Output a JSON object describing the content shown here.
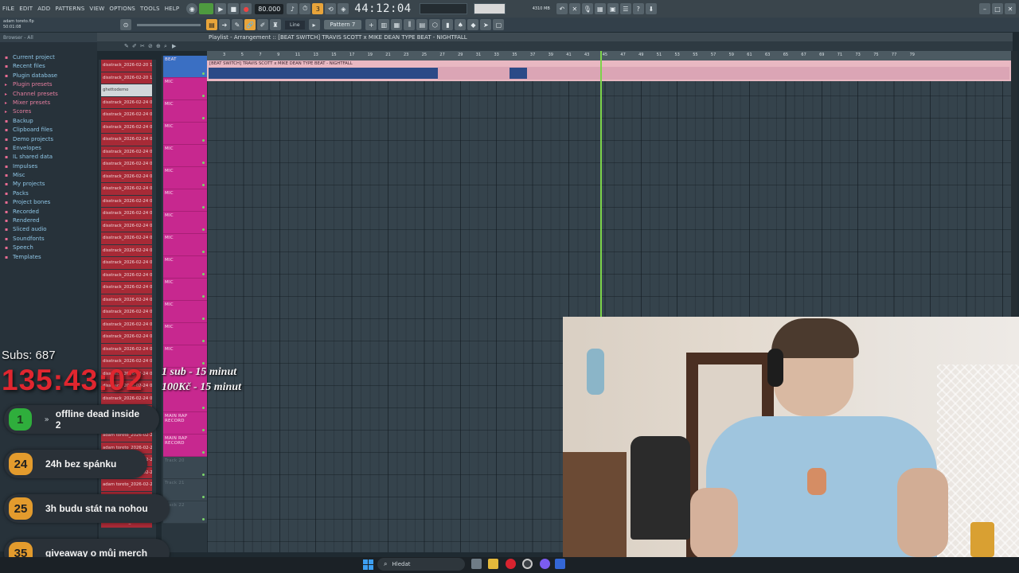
{
  "menubar": {
    "items": [
      "FILE",
      "EDIT",
      "ADD",
      "PATTERNS",
      "VIEW",
      "OPTIONS",
      "TOOLS",
      "HELP"
    ],
    "tempo": "80.000",
    "time": "44:12:04",
    "cpu_label": "4310 MB",
    "pattern": "Pattern 7",
    "snap": "Line"
  },
  "song": {
    "author": "adam toreto.flp",
    "time": "50:01:08"
  },
  "browser": {
    "header": "Browser - All",
    "items": [
      {
        "label": "Current project",
        "color": "blue"
      },
      {
        "label": "Recent files",
        "color": "blue"
      },
      {
        "label": "Plugin database",
        "color": "blue"
      },
      {
        "label": "Plugin presets",
        "color": "red"
      },
      {
        "label": "Channel presets",
        "color": "red"
      },
      {
        "label": "Mixer presets",
        "color": "red"
      },
      {
        "label": "Scores",
        "color": "red"
      },
      {
        "label": "Backup",
        "color": "blue"
      },
      {
        "label": "Clipboard files",
        "color": "blue"
      },
      {
        "label": "Demo projects",
        "color": "blue"
      },
      {
        "label": "Envelopes",
        "color": "blue"
      },
      {
        "label": "IL shared data",
        "color": "blue"
      },
      {
        "label": "Impulses",
        "color": "blue"
      },
      {
        "label": "Misc",
        "color": "blue"
      },
      {
        "label": "My projects",
        "color": "blue"
      },
      {
        "label": "Packs",
        "color": "blue"
      },
      {
        "label": "Project bones",
        "color": "blue"
      },
      {
        "label": "Recorded",
        "color": "blue"
      },
      {
        "label": "Rendered",
        "color": "blue"
      },
      {
        "label": "Sliced audio",
        "color": "blue"
      },
      {
        "label": "Soundfonts",
        "color": "blue"
      },
      {
        "label": "Speech",
        "color": "blue"
      },
      {
        "label": "Templates",
        "color": "blue"
      }
    ]
  },
  "playlist": {
    "title": "Playlist - Arrangement :: [BEAT SWITCH] TRAVIS SCOTT x MIKE DEAN TYPE BEAT - NIGHTFALL",
    "clip_title": "[BEAT SWITCH] TRAVIS SCOTT x MIKE DEAN TYPE BEAT - NIGHTFALL",
    "ruler": [
      "3",
      "5",
      "7",
      "9",
      "11",
      "13",
      "15",
      "17",
      "19",
      "21",
      "23",
      "25",
      "27",
      "29",
      "31",
      "33",
      "35",
      "37",
      "39",
      "41",
      "43",
      "45",
      "47",
      "49",
      "51",
      "53",
      "55",
      "57",
      "59",
      "61",
      "63",
      "65",
      "67",
      "69",
      "71",
      "73",
      "75",
      "77",
      "79"
    ],
    "patterns": [
      "disstrack_2026-02-20 15...",
      "disstrack_2026-02-20 15...",
      "ghettodemo",
      "disstrack_2026-02-24 06...",
      "disstrack_2026-02-24 06...",
      "disstrack_2026-02-24 06...",
      "disstrack_2026-02-24 06...",
      "disstrack_2026-02-24 06...",
      "disstrack_2026-02-24 06...",
      "disstrack_2026-02-24 06...",
      "disstrack_2026-02-24 06...",
      "disstrack_2026-02-24 06...",
      "disstrack_2026-02-24 06...",
      "disstrack_2026-02-24 06...",
      "disstrack_2026-02-24 06...",
      "disstrack_2026-02-24 06...",
      "disstrack_2026-02-24 06...",
      "disstrack_2026-02-24 06...",
      "disstrack_2026-02-24 06...",
      "disstrack_2026-02-24 06...",
      "disstrack_2026-02-24 06...",
      "disstrack_2026-02-24 06...",
      "disstrack_2026-02-24 06...",
      "disstrack_2026-02-24 06...",
      "disstrack_2026-02-24 06...",
      "disstrack_2026-02-24 06...",
      "disstrack_2026-02-24 06...",
      "disstrack_2026-02-24 06...",
      "disstrack_2026-02-24 06...",
      "adam toreto_2026-02-2...",
      "adam toreto_2026-02-2...",
      "adam toreto_2026-02-2...",
      "adam toreto_2026-02-2...",
      "adam toreto_2026-02-2...",
      "adam toreto_2026-02-2...",
      "adam toreto_2026-02-2...",
      "adam toreto_2026-02-2...",
      "adam toreto_2026-02-2..."
    ],
    "tracks": {
      "beat": "BEAT",
      "mic": "MIC",
      "main_rap": "MAIN RAP RECORD",
      "track20": "Track 20",
      "track21": "Track 21",
      "track22": "Track 22"
    }
  },
  "overlay": {
    "subs_label": "Subs:",
    "subs_count": "687",
    "timer": "135:43:02",
    "rule1": "1 sub - 15 minut",
    "rule2": "100Kč - 15 minut",
    "goals": [
      {
        "num": "1",
        "text": "offline dead inside 2",
        "active": true
      },
      {
        "num": "24",
        "text": "24h bez spánku",
        "active": false
      },
      {
        "num": "25",
        "text": "3h budu stát na nohou",
        "active": false
      },
      {
        "num": "35",
        "text": "giveaway o můj merch",
        "active": false
      }
    ]
  },
  "taskbar": {
    "search_placeholder": "Hledat"
  }
}
